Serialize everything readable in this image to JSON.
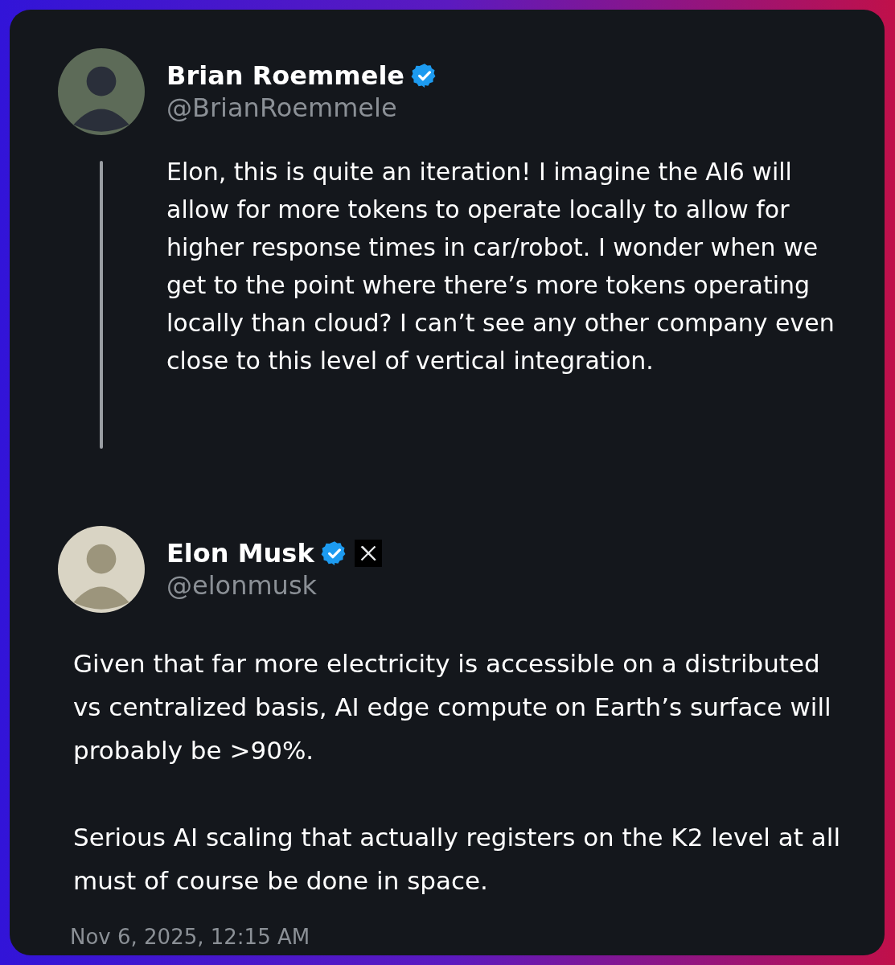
{
  "parent_post": {
    "author_name": "Brian Roemmele",
    "verified": true,
    "handle": "@BrianRoemmele",
    "text": "Elon, this is quite an iteration! I imagine the AI6 will allow for more tokens to operate locally to allow for higher response times in car/robot. I wonder when we get to the point where there’s more tokens operating locally than cloud? I can’t see any other company even close to this level of vertical integration."
  },
  "reply": {
    "author_name": "Elon Musk",
    "verified": true,
    "affiliate_badge": true,
    "handle": "@elonmusk",
    "paragraphs": [
      "Given that far more electricity is accessible on a distributed vs centralized basis, AI edge compute on Earth’s surface will probably be >90%.",
      "Serious AI scaling that actually registers on the K2 level at all must of course be done in space."
    ],
    "timestamp": "Nov 6, 2025, 12:15 AM"
  }
}
